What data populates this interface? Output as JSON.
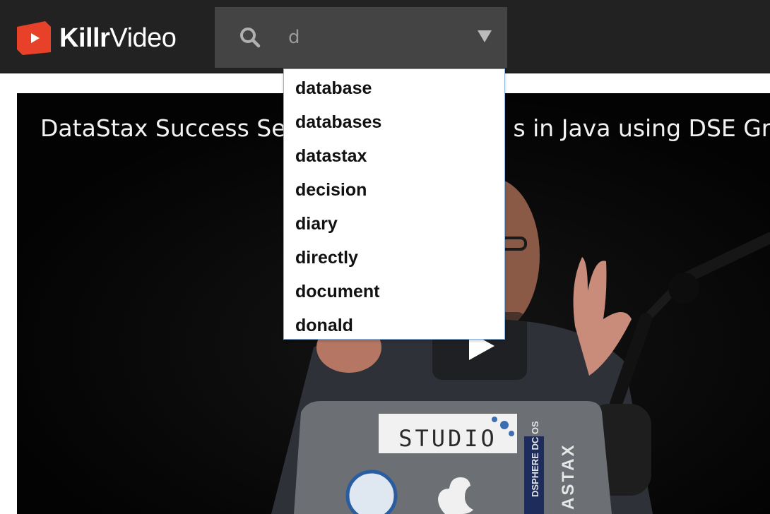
{
  "header": {
    "logo_text_bold": "Killr",
    "logo_text_light": "Video",
    "logo_icon": "play-icon",
    "brand_color": "#e8412a"
  },
  "search": {
    "query": "d",
    "icon": "search-icon",
    "caret_icon": "caret-down-icon",
    "suggestions": [
      "database",
      "databases",
      "datastax",
      "decision",
      "diary",
      "directly",
      "document",
      "donald"
    ]
  },
  "video": {
    "title": "DataStax Success Seg",
    "title_tail": "s in Java using DSE Grap",
    "play_icon": "play-icon",
    "sticker_studio": "STUDIO",
    "sticker_dcos": "DSPHERE DC OS",
    "sticker_astax": "ASTAX"
  }
}
